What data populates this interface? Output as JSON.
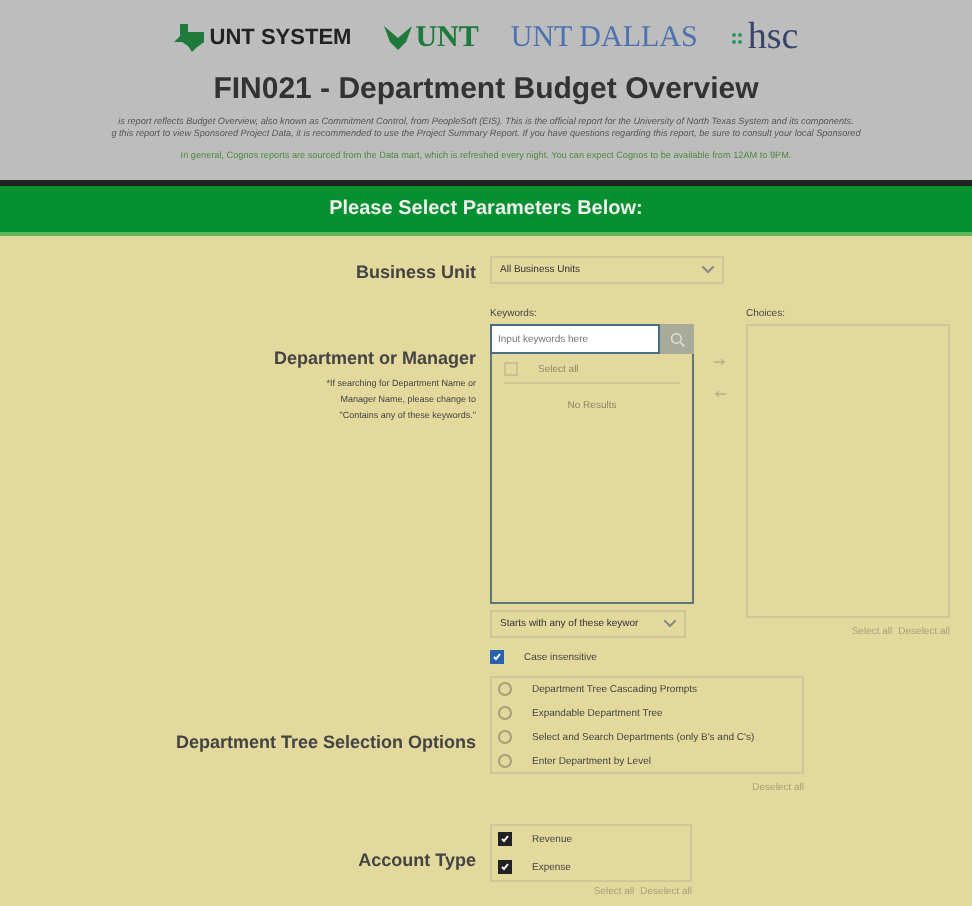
{
  "header": {
    "logos": [
      {
        "kind": "system",
        "text": "UNT SYSTEM"
      },
      {
        "kind": "unt",
        "text": "UNT"
      },
      {
        "kind": "dallas",
        "text": "UNT DALLAS"
      },
      {
        "kind": "hsc",
        "text": "hsc"
      }
    ],
    "title": "FIN021 - Department Budget Overview",
    "intro": [
      "is report reflects Budget Overview, also known as Commitment Control, from PeopleSoft (EIS). This is the official report for the University of North Texas System and its components.",
      "g this report to view Sponsored Project Data, it is recommended to use the Project Summary Report. If you have questions regarding this report, be sure to consult your local Sponsored"
    ],
    "note": "In general, Cognos reports are sourced from the Data mart, which is refreshed every night. You can expect Cognos to be available from 12AM to 9PM."
  },
  "banner": "Please Select Parameters Below:",
  "business_unit": {
    "label": "Business Unit",
    "value": "All Business Units"
  },
  "department": {
    "label": "Department or Manager",
    "hint": "*If searching for Department Name or Manager Name, please change to \"Contains any of these keywords.\"",
    "keywords_label": "Keywords:",
    "placeholder": "Input keywords here",
    "select_all": "Select all",
    "select_all_checked": false,
    "empty": "No Results",
    "match_mode": "Starts with any of these keywor",
    "case_insensitive": {
      "label": "Case insensitive",
      "checked": true
    },
    "choices_label": "Choices:",
    "choices_links": [
      "Select all",
      "Deselect all"
    ]
  },
  "tree_options": {
    "label": "Department Tree Selection Options",
    "options": [
      {
        "label": "Department Tree Cascading Prompts",
        "selected": false
      },
      {
        "label": "Expandable Department Tree",
        "selected": false
      },
      {
        "label": "Select and Search Departments (only B's and C's)",
        "selected": false
      },
      {
        "label": "Enter Department by Level",
        "selected": false
      }
    ],
    "links": [
      "Deselect all"
    ]
  },
  "account_type": {
    "label": "Account Type",
    "options": [
      {
        "label": "Revenue",
        "checked": true
      },
      {
        "label": "Expense",
        "checked": true
      }
    ],
    "links": [
      "Select all",
      "Deselect all"
    ]
  }
}
